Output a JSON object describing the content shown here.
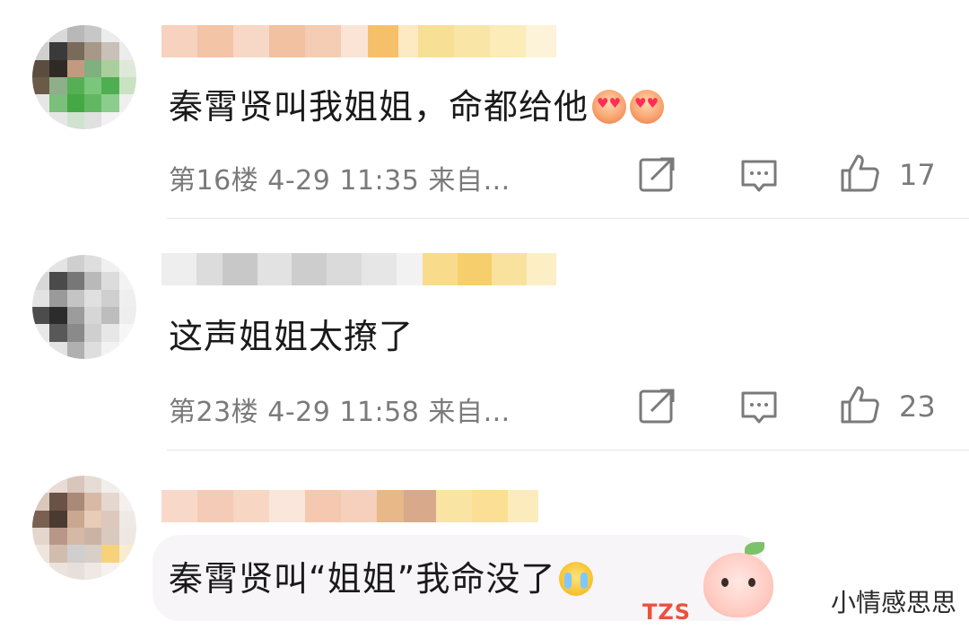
{
  "comments": [
    {
      "text": "秦霄贤叫我姐姐，命都给他",
      "emoji": "heart-eyes-face-icon",
      "floor": "第16楼",
      "time": "4-29 11:35",
      "source": "来自…",
      "likes": "17"
    },
    {
      "text": "这声姐姐太撩了",
      "emoji": "",
      "floor": "第23楼",
      "time": "4-29 11:58",
      "source": "来自…",
      "likes": "23"
    },
    {
      "text": "秦霄贤叫“姐姐”我命没了",
      "emoji": "crying-face-icon",
      "floor": "",
      "time": "",
      "source": "",
      "likes": ""
    }
  ],
  "sticker": {
    "label": "TZS"
  },
  "watermark": "小情感思思",
  "colors": {
    "text": "#1a1a1a",
    "meta": "#7a7a7a",
    "divider": "#e6e6e6"
  }
}
